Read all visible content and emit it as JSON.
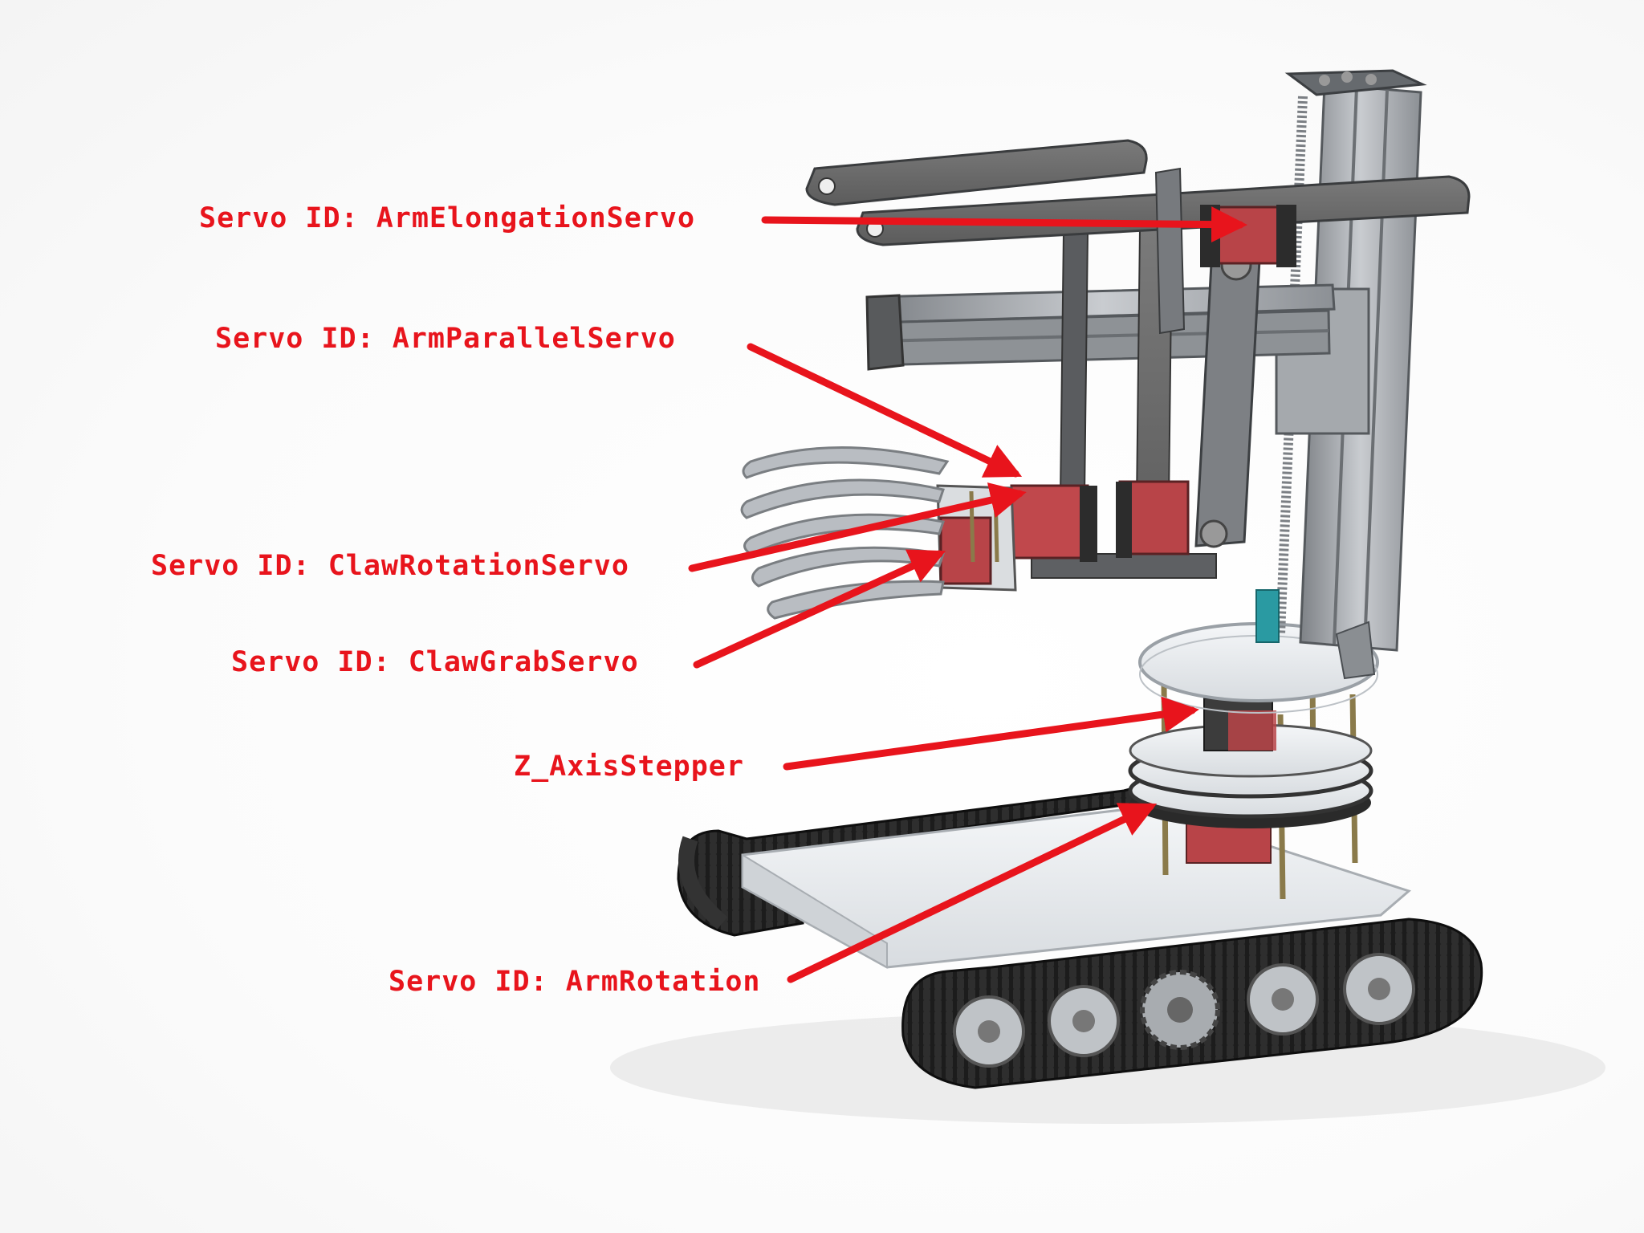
{
  "colors": {
    "annotation": "#e8141c",
    "servo_body": "#c0474a",
    "aluminum": "#9a9ea3",
    "plate_dark": "#6b6b6b",
    "track": "#1b1b1b",
    "acrylic": "#e9ecef"
  },
  "labels": {
    "arm_elongation": "Servo ID: ArmElongationServo",
    "arm_parallel": "Servo ID: ArmParallelServo",
    "claw_rotation": "Servo ID: ClawRotationServo",
    "claw_grab": "Servo ID: ClawGrabServo",
    "z_axis": "Z_AxisStepper",
    "arm_rotation": "Servo ID: ArmRotation"
  }
}
